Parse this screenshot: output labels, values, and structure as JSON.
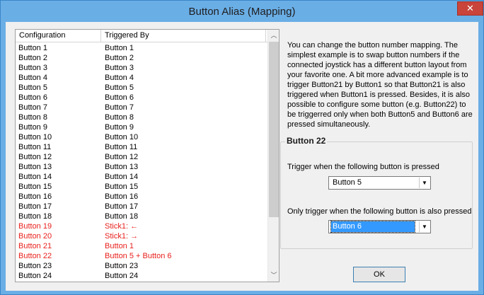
{
  "window": {
    "title": "Button Alias (Mapping)",
    "close_glyph": "✕"
  },
  "list": {
    "headers": [
      "Configuration",
      "Triggered By"
    ],
    "rows": [
      {
        "config": "Button 1",
        "trigger": "Button 1",
        "highlight": false
      },
      {
        "config": "Button 2",
        "trigger": "Button 2",
        "highlight": false
      },
      {
        "config": "Button 3",
        "trigger": "Button 3",
        "highlight": false
      },
      {
        "config": "Button 4",
        "trigger": "Button 4",
        "highlight": false
      },
      {
        "config": "Button 5",
        "trigger": "Button 5",
        "highlight": false
      },
      {
        "config": "Button 6",
        "trigger": "Button 6",
        "highlight": false
      },
      {
        "config": "Button 7",
        "trigger": "Button 7",
        "highlight": false
      },
      {
        "config": "Button 8",
        "trigger": "Button 8",
        "highlight": false
      },
      {
        "config": "Button 9",
        "trigger": "Button 9",
        "highlight": false
      },
      {
        "config": "Button 10",
        "trigger": "Button 10",
        "highlight": false
      },
      {
        "config": "Button 11",
        "trigger": "Button 11",
        "highlight": false
      },
      {
        "config": "Button 12",
        "trigger": "Button 12",
        "highlight": false
      },
      {
        "config": "Button 13",
        "trigger": "Button 13",
        "highlight": false
      },
      {
        "config": "Button 14",
        "trigger": "Button 14",
        "highlight": false
      },
      {
        "config": "Button 15",
        "trigger": "Button 15",
        "highlight": false
      },
      {
        "config": "Button 16",
        "trigger": "Button 16",
        "highlight": false
      },
      {
        "config": "Button 17",
        "trigger": "Button 17",
        "highlight": false
      },
      {
        "config": "Button 18",
        "trigger": "Button 18",
        "highlight": false
      },
      {
        "config": "Button 19",
        "trigger": "Stick1: ←",
        "highlight": true
      },
      {
        "config": "Button 20",
        "trigger": "Stick1: →",
        "highlight": true
      },
      {
        "config": "Button 21",
        "trigger": "Button 1",
        "highlight": true
      },
      {
        "config": "Button 22",
        "trigger": "Button 5 + Button 6",
        "highlight": true
      },
      {
        "config": "Button 23",
        "trigger": "Button 23",
        "highlight": false
      },
      {
        "config": "Button 24",
        "trigger": "Button 24",
        "highlight": false
      }
    ],
    "scroll_up_glyph": "︿",
    "scroll_down_glyph": "﹀"
  },
  "description": "You can change the button number mapping.  The simplest example is to swap button numbers if the connected joystick has a different button layout from your favorite one.  A bit more advanced example is to trigger Button21 by Button1 so that Button21 is also triggered when Button1 is pressed.  Besides, it is also possible to configure some button (e.g. Button22) to be triggerred only when both Button5 and Button6 are pressed simultaneously.",
  "group": {
    "title": "Button 22",
    "trigger_label": "Trigger when the following button is pressed",
    "trigger_value": "Button 5",
    "also_label": "Only trigger when the following button is also pressed",
    "also_value": "Button 6",
    "dropdown_glyph": "▼"
  },
  "ok_label": "OK",
  "colors": {
    "titlebar": "#6aaee6",
    "highlight_text": "#e8201c",
    "selection": "#3399ff",
    "close": "#c9443a"
  }
}
